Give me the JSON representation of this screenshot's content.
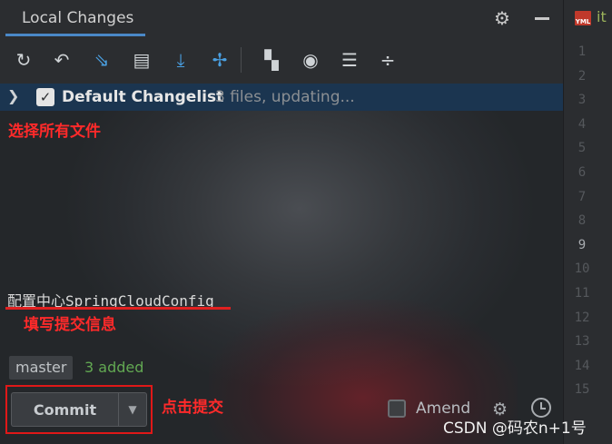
{
  "panel": {
    "tab_title": "Local Changes",
    "toolbar_icons": [
      "refresh-icon",
      "rollback-icon",
      "diff-icon",
      "shelve-icon",
      "update-icon",
      "merge-icon",
      "group-by-icon",
      "view-options-icon",
      "expand-all-icon",
      "collapse-all-icon"
    ]
  },
  "changelist": {
    "name": "Default Changelist",
    "meta": "3 files, updating...",
    "checked": true
  },
  "annotations": {
    "select_all": "选择所有文件",
    "fill_message": "填写提交信息",
    "click_commit": "点击提交"
  },
  "commit": {
    "message": "配置中心SpringCloudConfig",
    "branch": "master",
    "status": "3 added",
    "button_label": "Commit",
    "amend_label": "Amend"
  },
  "editor": {
    "tab_text": "it",
    "file_badge": "YML",
    "line_numbers": [
      "1",
      "2",
      "3",
      "4",
      "5",
      "6",
      "7",
      "8",
      "9",
      "10",
      "11",
      "12",
      "13",
      "14",
      "15"
    ],
    "active_line": "9"
  },
  "watermark": "CSDN @码农n+1号",
  "colors": {
    "accent_blue": "#4a88c7",
    "changelist_bg": "#1b3550",
    "annotation_red": "#ff2a2a",
    "added_green": "#62a852"
  }
}
